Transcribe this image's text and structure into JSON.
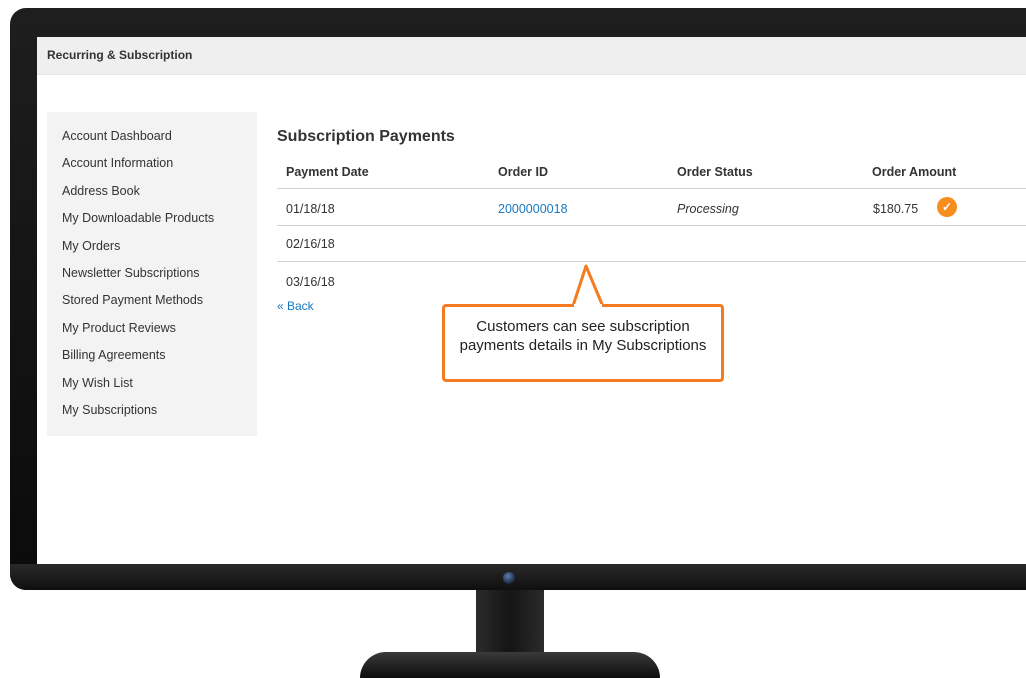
{
  "page": {
    "title": "Recurring & Subscription"
  },
  "sidebar": {
    "items": [
      {
        "label": "Account Dashboard"
      },
      {
        "label": "Account Information"
      },
      {
        "label": "Address Book"
      },
      {
        "label": "My Downloadable Products"
      },
      {
        "label": "My Orders"
      },
      {
        "label": "Newsletter Subscriptions"
      },
      {
        "label": "Stored Payment Methods"
      },
      {
        "label": "My Product Reviews"
      },
      {
        "label": "Billing Agreements"
      },
      {
        "label": "My Wish List"
      },
      {
        "label": "My Subscriptions"
      }
    ]
  },
  "main": {
    "section_title": "Subscription Payments",
    "columns": [
      "Payment Date",
      "Order ID",
      "Order Status",
      "Order Amount"
    ],
    "rows": [
      {
        "date": "01/18/18",
        "order_id": "2000000018",
        "status": "Processing",
        "amount": "$180.75",
        "paid": true
      },
      {
        "date": "02/16/18",
        "order_id": "",
        "status": "",
        "amount": ""
      },
      {
        "date": "03/16/18",
        "order_id": "",
        "status": "",
        "amount": ""
      }
    ],
    "back_link": "« Back"
  },
  "callout": {
    "text": "Customers can see subscription payments details in My Subscriptions"
  },
  "colors": {
    "accent": "#f47b20",
    "link": "#1979c3",
    "check": "#f78d1e"
  },
  "icons": {
    "paid_status": "check-circle-icon",
    "webcam": "camera-icon"
  }
}
